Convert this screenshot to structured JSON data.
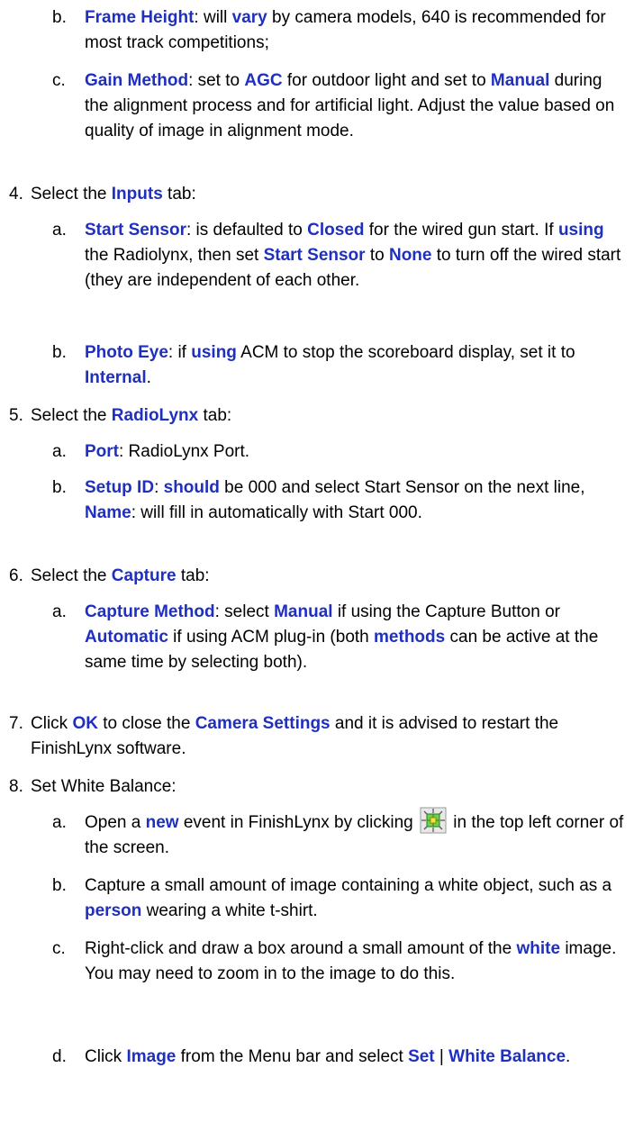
{
  "items": [
    {
      "marker": "b.",
      "segments": [
        {
          "t": "Frame Height",
          "hl": true
        },
        {
          "t": ": will "
        },
        {
          "t": "vary",
          "hl": true
        },
        {
          "t": " by camera models, 640 is recommended for most track competitions;"
        }
      ]
    },
    {
      "marker": "c.",
      "segments": [
        {
          "t": "Gain Method",
          "hl": true
        },
        {
          "t": ": set to "
        },
        {
          "t": "AGC",
          "hl": true
        },
        {
          "t": " for outdoor light and set to "
        },
        {
          "t": "Manual",
          "hl": true
        },
        {
          "t": " during the alignment process and for artificial light. Adjust the value based on quality of image in alignment mode."
        }
      ]
    },
    {
      "marker": "4.",
      "segments": [
        {
          "t": "Select the "
        },
        {
          "t": "Inputs",
          "hl": true
        },
        {
          "t": " tab:"
        }
      ]
    },
    {
      "marker": "a.",
      "segments": [
        {
          "t": "Start Sensor",
          "hl": true
        },
        {
          "t": ": is defaulted to "
        },
        {
          "t": "Closed",
          "hl": true
        },
        {
          "t": " for the wired gun start. If "
        },
        {
          "t": "using",
          "hl": true
        },
        {
          "t": " the Radiolynx, then set "
        },
        {
          "t": "Start Sensor",
          "hl": true
        },
        {
          "t": " to "
        },
        {
          "t": "None",
          "hl": true
        },
        {
          "t": " to turn off the wired start (they are independent of each other."
        }
      ]
    },
    {
      "marker": "b.",
      "segments": [
        {
          "t": "Photo Eye",
          "hl": true
        },
        {
          "t": ": if "
        },
        {
          "t": "using",
          "hl": true
        },
        {
          "t": " ACM to stop the scoreboard display, set it to "
        },
        {
          "t": "Internal",
          "hl": true
        },
        {
          "t": "."
        }
      ]
    },
    {
      "marker": "5.",
      "segments": [
        {
          "t": "Select the "
        },
        {
          "t": "RadioLynx",
          "hl": true
        },
        {
          "t": " tab:"
        }
      ]
    },
    {
      "marker": "a.",
      "segments": [
        {
          "t": "Port",
          "hl": true
        },
        {
          "t": ": RadioLynx Port."
        }
      ]
    },
    {
      "marker": "b.",
      "segments": [
        {
          "t": "Setup ID",
          "hl": true
        },
        {
          "t": ": "
        },
        {
          "t": "should",
          "hl": true
        },
        {
          "t": " be 000 and select Start Sensor on the next line, "
        },
        {
          "t": "Name",
          "hl": true
        },
        {
          "t": ": will fill in automatically with Start 000."
        }
      ]
    },
    {
      "marker": "6.",
      "segments": [
        {
          "t": "Select the "
        },
        {
          "t": "Capture",
          "hl": true
        },
        {
          "t": " tab:"
        }
      ]
    },
    {
      "marker": "a.",
      "segments": [
        {
          "t": "Capture Method",
          "hl": true
        },
        {
          "t": ": select "
        },
        {
          "t": "Manual",
          "hl": true
        },
        {
          "t": " if using the Capture Button or "
        },
        {
          "t": "Automatic",
          "hl": true
        },
        {
          "t": " if using ACM plug-in (both "
        },
        {
          "t": "methods",
          "hl": true
        },
        {
          "t": " can be active at the same time by selecting both)."
        }
      ]
    },
    {
      "marker": "7.",
      "segments": [
        {
          "t": "Click "
        },
        {
          "t": "OK",
          "hl": true
        },
        {
          "t": " to close the "
        },
        {
          "t": "Camera Settings",
          "hl": true
        },
        {
          "t": " and it is advised to restart the FinishLynx software."
        }
      ]
    },
    {
      "marker": "8.",
      "segments": [
        {
          "t": "Set White Balance:"
        }
      ]
    },
    {
      "marker": "a.",
      "segments": [
        {
          "t": "Open a "
        },
        {
          "t": "new",
          "hl": true
        },
        {
          "t": " event in FinishLynx by clicking "
        },
        {
          "icon": "new-event-icon"
        },
        {
          "t": " in the top left corner of the screen."
        }
      ]
    },
    {
      "marker": "b.",
      "segments": [
        {
          "t": "Capture a small amount of image containing a white object, such as a "
        },
        {
          "t": "person",
          "hl": true
        },
        {
          "t": " wearing a white t-shirt."
        }
      ]
    },
    {
      "marker": "c.",
      "segments": [
        {
          "t": "Right-click and draw a box around a small amount of the "
        },
        {
          "t": "white",
          "hl": true
        },
        {
          "t": " image.  You may need to zoom in to the image to do this."
        }
      ]
    },
    {
      "marker": "d.",
      "segments": [
        {
          "t": "Click "
        },
        {
          "t": "Image",
          "hl": true
        },
        {
          "t": " from the Menu bar and select "
        },
        {
          "t": "Set",
          "hl": true
        },
        {
          "t": " | "
        },
        {
          "t": "White Balance",
          "hl": true
        },
        {
          "t": "."
        }
      ]
    }
  ]
}
